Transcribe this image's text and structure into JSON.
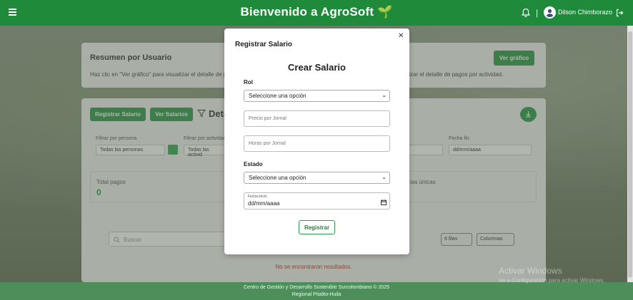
{
  "header": {
    "title": "Bienvenido a AgroSoft",
    "title_emoji": "🌱",
    "separator": "|",
    "user_name": "Dilson Chimborazo"
  },
  "background_page": {
    "summary": {
      "title": "Resumen por Usuario",
      "description_left": "Haz clic en \"Ver gráfico\" para visualizar el detalle de p",
      "description_right": "alizar el detalle de pagos por actividad.",
      "chart_button": "Ver gráfico"
    },
    "detail": {
      "register_button": "Registrar Salario",
      "view_salaries_button": "Ver Salarios",
      "heading_partial": "Deta",
      "filter_person_label": "Filtrar por persona",
      "filter_person_value": "Todas las personas",
      "filter_activity_label": "Filtrar por actividad",
      "filter_activity_value": "Todas las activid",
      "end_date_label": "Fecha fin",
      "end_date_value": "dd/mm/aaaa",
      "total_payments_label": "Total pagos",
      "total_payments_value": "0",
      "unique_persons_label": "onas únicas",
      "search_placeholder": "Buscar",
      "rows_select": "6 filas",
      "columns_select": "Columnas",
      "no_results": "No se encontraron resultados."
    }
  },
  "footer": {
    "line1": "Centro de Gestión y Desarrollo Sostenible Surcolombiano © 2025",
    "line2": "Regional Pitalito-Huila"
  },
  "watermark": {
    "line1": "Activar Windows",
    "line2": "Ve a Configuración para activar Windows."
  },
  "modal": {
    "title": "Registrar Salario",
    "form_title": "Crear Salario",
    "rol_label": "Rol",
    "rol_select": "Seleccione una opción",
    "precio_placeholder": "Precio por Jornal",
    "horas_placeholder": "Horas por Jornal",
    "estado_label": "Estado",
    "estado_select": "Seleccione una opción",
    "fecha_inicio_label": "Fecha inicio",
    "fecha_inicio_value": "dd/mm/aaaa",
    "submit_button": "Registrar"
  },
  "colors": {
    "primary": "#1e8a3a",
    "button_green": "#2e9a4a",
    "error": "#c0392b"
  }
}
